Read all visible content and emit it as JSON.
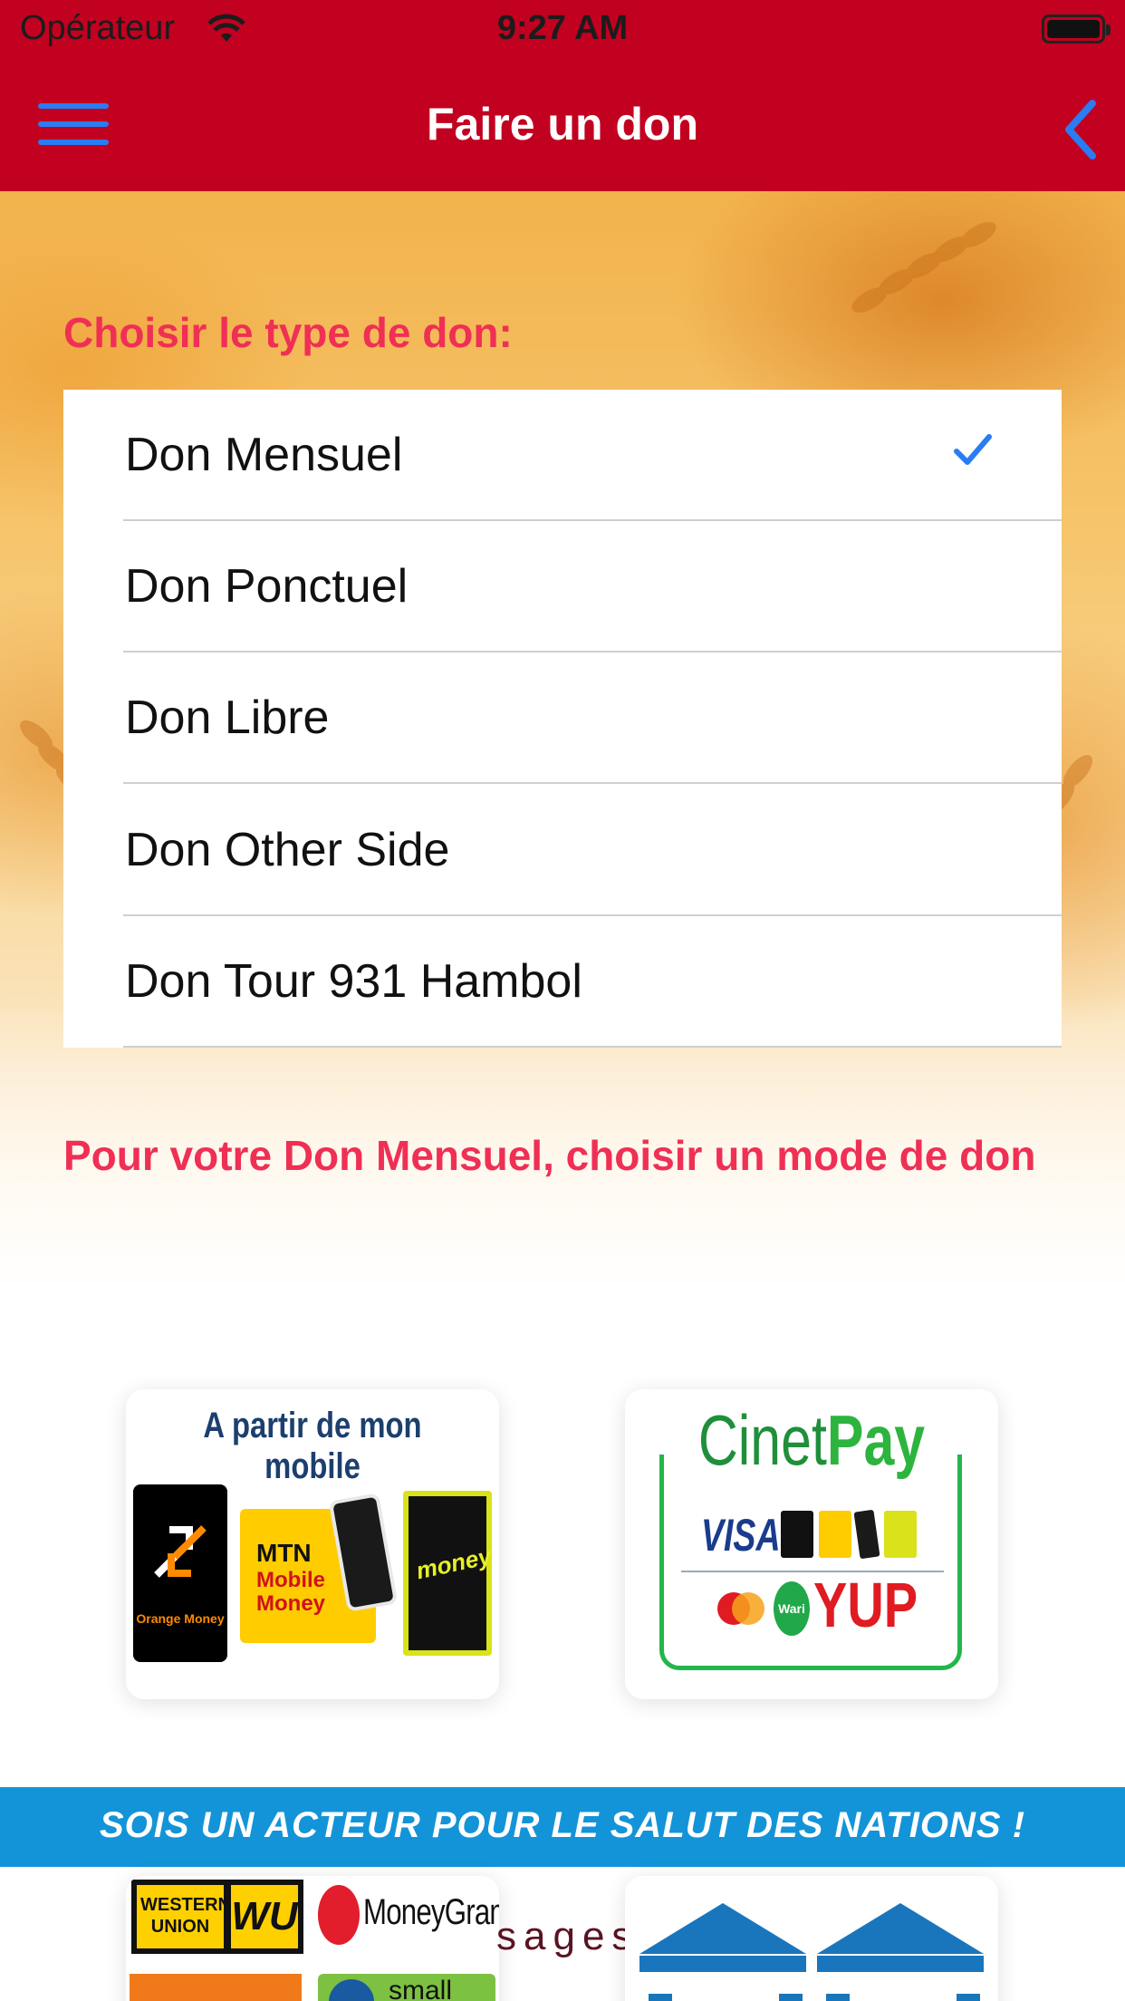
{
  "status_bar": {
    "carrier": "Opérateur",
    "time": "9:27 AM",
    "wifi_icon": "wifi-icon",
    "battery_icon": "battery-icon"
  },
  "nav": {
    "title": "Faire un don",
    "menu_icon": "hamburger-menu-icon",
    "back_icon": "chevron-left-icon",
    "bar_color": "#c20020",
    "icon_color": "#2a7cf2"
  },
  "type_section": {
    "label": "Choisir le type de don:",
    "label_color": "#f02f55",
    "options": [
      {
        "label": "Don Mensuel",
        "selected": true
      },
      {
        "label": "Don Ponctuel",
        "selected": false
      },
      {
        "label": "Don Libre",
        "selected": false
      },
      {
        "label": "Don Other Side",
        "selected": false
      },
      {
        "label": "Don Tour 931 Hambol",
        "selected": false
      }
    ],
    "check_icon": "checkmark-icon"
  },
  "mode_section": {
    "label": "Pour votre Don Mensuel, choisir un mode de don"
  },
  "payment_cards": {
    "mobile": {
      "title": "A partir de mon mobile",
      "orange_label": "Orange Money",
      "mtn_label": "MTN",
      "mtn_sub": "Mobile Money",
      "moov_label": "money"
    },
    "cinetpay": {
      "title_part1": "Cinet",
      "title_part2": "Pay",
      "visa": "VISA",
      "wari": "Wari",
      "yup": "YUP"
    }
  },
  "banner": {
    "text": "SOIS UN ACTEUR POUR LE SALUT DES NATIONS !",
    "color": "#1494d8"
  },
  "bottom_cards": {
    "transfer": {
      "wu_label": "WESTERN UNION",
      "wu_logo": "WU",
      "moneygram": "MoneyGram.",
      "small": "small"
    },
    "partial_text": "sages"
  }
}
